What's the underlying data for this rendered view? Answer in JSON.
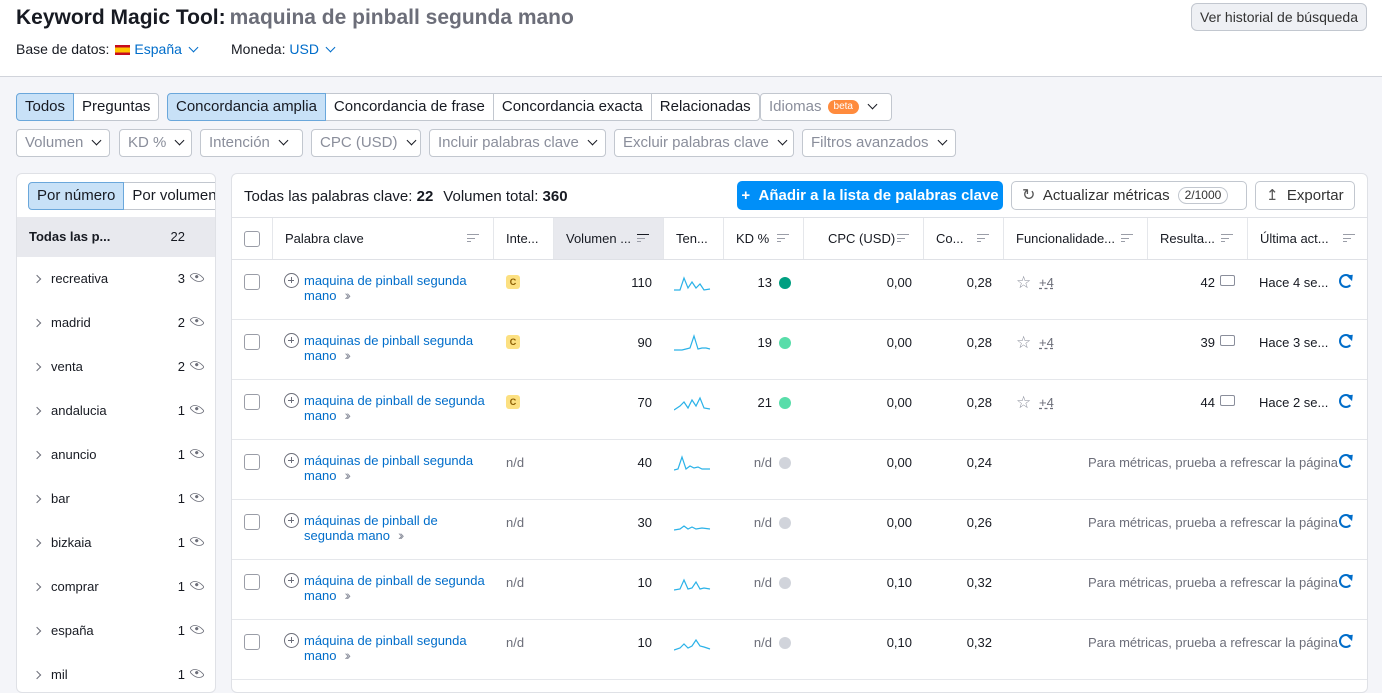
{
  "header": {
    "title": "Keyword Magic Tool:",
    "query": "maquina de pinball segunda mano",
    "history_button": "Ver historial de búsqueda",
    "database_label": "Base de datos:",
    "database_value": "España",
    "currency_label": "Moneda:",
    "currency_value": "USD"
  },
  "match_tabs": [
    "Todos",
    "Preguntas"
  ],
  "match_types": [
    "Concordancia amplia",
    "Concordancia de frase",
    "Concordancia exacta",
    "Relacionadas"
  ],
  "languages": {
    "label": "Idiomas",
    "badge": "beta"
  },
  "filters": [
    "Volumen",
    "KD %",
    "Intención",
    "CPC (USD)",
    "Incluir palabras clave",
    "Excluir palabras clave",
    "Filtros avanzados"
  ],
  "groups": {
    "tabs": [
      "Por número",
      "Por volumen"
    ],
    "all_label": "Todas las p...",
    "all_count": "22",
    "items": [
      {
        "name": "recreativa",
        "count": "3"
      },
      {
        "name": "madrid",
        "count": "2"
      },
      {
        "name": "venta",
        "count": "2"
      },
      {
        "name": "andalucia",
        "count": "1"
      },
      {
        "name": "anuncio",
        "count": "1"
      },
      {
        "name": "bar",
        "count": "1"
      },
      {
        "name": "bizkaia",
        "count": "1"
      },
      {
        "name": "comprar",
        "count": "1"
      },
      {
        "name": "españa",
        "count": "1"
      },
      {
        "name": "mil",
        "count": "1"
      }
    ]
  },
  "summary": {
    "all_label": "Todas las palabras clave:",
    "all_count": "22",
    "volume_label": "Volumen total:",
    "volume_total": "360"
  },
  "toolbar": {
    "add_button": "Añadir a la lista de palabras clave",
    "update_button": "Actualizar métricas",
    "update_quota": "2/1000",
    "export_button": "Exportar"
  },
  "columns": [
    "Palabra clave",
    "Inte...",
    "Volumen ...",
    "Ten...",
    "KD %",
    "CPC (USD)",
    "Co...",
    "Funcionalidade...",
    "Resulta...",
    "Última act..."
  ],
  "colors": {
    "accent": "#008ff8",
    "kd_hard": "#009f81",
    "kd_medium": "#59ddaa",
    "kd_na": "#d1d4db"
  },
  "rows": [
    {
      "keyword_line1": "maquina de pinball segunda",
      "keyword_line2": "mano",
      "intent": "C",
      "volume": "110",
      "kd": "13",
      "cpc": "0,00",
      "comp": "0,28",
      "features_more": "+4",
      "results": "42",
      "updated": "Hace 4 se..."
    },
    {
      "keyword_line1": "maquinas de pinball segunda",
      "keyword_line2": "mano",
      "intent": "C",
      "volume": "90",
      "kd": "19",
      "cpc": "0,00",
      "comp": "0,28",
      "features_more": "+4",
      "results": "39",
      "updated": "Hace 3 se..."
    },
    {
      "keyword_line1": "maquina de pinball de segunda",
      "keyword_line2": "mano",
      "intent": "C",
      "volume": "70",
      "kd": "21",
      "cpc": "0,00",
      "comp": "0,28",
      "features_more": "+4",
      "results": "44",
      "updated": "Hace 2 se..."
    },
    {
      "keyword_line1": "máquinas de pinball segunda",
      "keyword_line2": "mano",
      "intent": "n/d",
      "volume": "40",
      "kd": "n/d",
      "cpc": "0,00",
      "comp": "0,24",
      "message": "Para métricas, prueba a refrescar la página"
    },
    {
      "keyword_line1": "máquinas de pinball de",
      "keyword_line2": "segunda mano",
      "intent": "n/d",
      "volume": "30",
      "kd": "n/d",
      "cpc": "0,00",
      "comp": "0,26",
      "message": "Para métricas, prueba a refrescar la página"
    },
    {
      "keyword_line1": "máquina de pinball de segunda",
      "keyword_line2": "mano",
      "intent": "n/d",
      "volume": "10",
      "kd": "n/d",
      "cpc": "0,10",
      "comp": "0,32",
      "message": "Para métricas, prueba a refrescar la página"
    },
    {
      "keyword_line1": "máquina de pinball segunda",
      "keyword_line2": "mano",
      "intent": "n/d",
      "volume": "10",
      "kd": "n/d",
      "cpc": "0,10",
      "comp": "0,32",
      "message": "Para métricas, prueba a refrescar la página"
    }
  ]
}
